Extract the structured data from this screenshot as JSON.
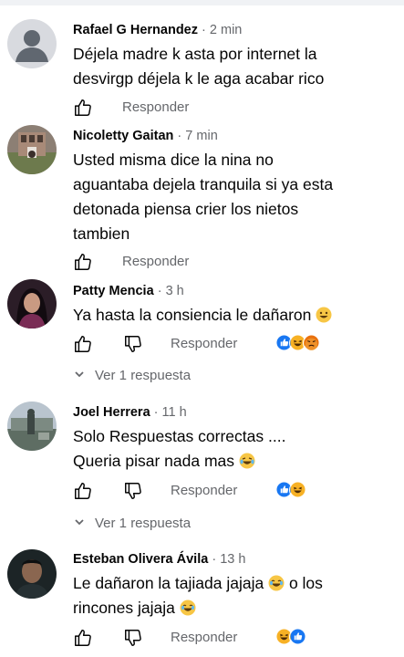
{
  "comments": [
    {
      "name": "Rafael G Hernandez",
      "time": "2 min",
      "lines": [
        "Déjela madre k asta por internet la",
        "desvirgp déjela k le aga acabar rico"
      ],
      "reply_label": "Responder"
    },
    {
      "name": "Nicoletty Gaitan",
      "time": "7 min",
      "lines": [
        "Usted misma dice la nina no",
        "aguantaba dejela tranquila si ya esta",
        "detonada piensa crier los nietos",
        "tambien"
      ],
      "reply_label": "Responder"
    },
    {
      "name": "Patty Mencia",
      "time": "3 h",
      "lines": [
        "Ya hasta la consiencia le dañaron"
      ],
      "reply_label": "Responder",
      "view_replies": "Ver 1 respuesta",
      "reactions": [
        "like",
        "haha",
        "angry"
      ]
    },
    {
      "name": "Joel Herrera",
      "time": "11 h",
      "lines": [
        "Solo Respuestas correctas ....",
        "Queria pisar nada mas"
      ],
      "reply_label": "Responder",
      "view_replies": "Ver 1 respuesta",
      "reactions": [
        "like",
        "haha"
      ]
    },
    {
      "name": "Esteban Olivera Ávila",
      "time": "13 h",
      "lines": [
        "Le dañaron la tajiada jajaja",
        "o los",
        "rincones jajaja"
      ],
      "reply_label": "Responder",
      "reactions": [
        "haha",
        "like"
      ]
    }
  ],
  "separator": "·",
  "icons": {
    "like": "thumbs-up-icon",
    "dislike": "thumbs-down-icon",
    "expand": "chevron-down-icon"
  },
  "colors": {
    "like_blue": "#1877f2",
    "haha_yellow": "#f7b125",
    "angry_red": "#e9710f",
    "secondary_text": "#65676b"
  }
}
